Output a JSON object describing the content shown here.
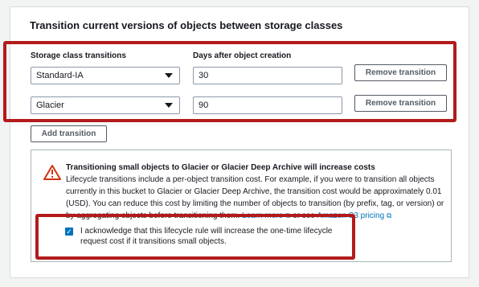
{
  "section": {
    "title": "Transition current versions of objects between storage classes"
  },
  "columns": {
    "storage_label": "Storage class transitions",
    "days_label": "Days after object creation"
  },
  "transitions": [
    {
      "storage_class": "Standard-IA",
      "days": "30",
      "remove_label": "Remove transition"
    },
    {
      "storage_class": "Glacier",
      "days": "90",
      "remove_label": "Remove transition"
    }
  ],
  "add_button": "Add transition",
  "alert": {
    "icon": "warning-icon",
    "title": "Transitioning small objects to Glacier or Glacier Deep Archive will increase costs",
    "body": "Lifecycle transitions include a per-object transition cost. For example, if you were to transition all objects currently in this bucket to Glacier or Glacier Deep Archive, the transition cost would be approximately 0.01 (USD). You can reduce this cost by limiting the number of objects to transition (by prefix, tag, or version) or by aggregating objects before transitioning them.",
    "learn_more": "Learn more",
    "or_see": "or see",
    "pricing_link": "Amazon S3 pricing",
    "acknowledge_checked": true,
    "acknowledge_text": "I acknowledge that this lifecycle rule will increase the one-time lifecycle request cost if it transitions small objects."
  },
  "colors": {
    "highlight": "#b31b1b",
    "link": "#0073bb",
    "warning": "#d13212"
  }
}
